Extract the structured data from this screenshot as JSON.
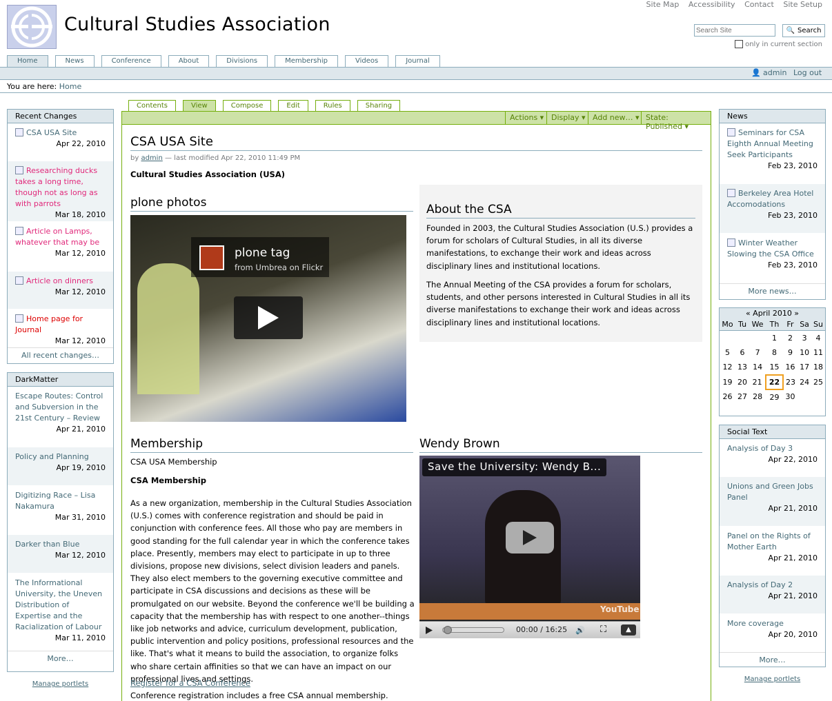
{
  "site_actions": [
    "Site Map",
    "Accessibility",
    "Contact",
    "Site Setup"
  ],
  "site_title": "Cultural Studies Association",
  "search": {
    "placeholder": "Search Site",
    "button": "Search",
    "only_current": "only in current section"
  },
  "global_tabs": [
    "Home",
    "News",
    "Conference",
    "About",
    "Divisions",
    "Membership",
    "Videos",
    "Journal"
  ],
  "personal": {
    "user": "admin",
    "logout": "Log out"
  },
  "breadcrumb": {
    "prefix": "You are here:",
    "home": "Home"
  },
  "content_tabs": [
    "Contents",
    "View",
    "Compose",
    "Edit",
    "Rules",
    "Sharing"
  ],
  "content_actions": [
    "Actions ▾",
    "Display ▾",
    "Add new… ▾",
    "State: Published ▾"
  ],
  "doc": {
    "title": "CSA USA Site",
    "byline_by": "by",
    "author": "admin",
    "byline_rest": "— last modified Apr 22, 2010 11:49 PM",
    "org": "Cultural Studies Association (USA)"
  },
  "plone_photos": {
    "heading": "plone photos",
    "video_title": "plone tag",
    "video_sub": "from Umbrea on Flickr"
  },
  "about": {
    "heading": "About the CSA",
    "p1": "Founded in 2003, the Cultural Studies Association (U.S.) provides a forum for scholars of Cultural Studies, in all its diverse manifestations, to exchange their work and ideas across disciplinary lines and institutional locations.",
    "p2": "The Annual Meeting of the CSA provides a forum for scholars, students, and other persons interested in Cultural Studies in all its diverse manifestations to exchange their work and ideas across disciplinary lines and institutional locations."
  },
  "membership": {
    "heading": "Membership",
    "sub": "CSA USA Membership",
    "bold": "CSA Membership",
    "body": "As a new organization, membership in the Cultural Studies Association (U.S.) comes with conference registration and should be paid in conjunction with conference fees. All those who pay are members in good standing for the full calendar year in which the conference takes place. Presently, members may elect to participate in up to three divisions, propose new divisions, select division leaders and panels. They also elect members to the governing executive committee and participate in CSA discussions and decisions as these will be promulgated on our website. Beyond the conference we'll be building a capacity that the membership has with respect to one another--things like job networks and advice, curriculum development, publication, public intervention and policy positions, professional resources and the like. That's what it means to build the association, to organize folks who share certain affinities so that we can have an impact on our professional lives and settings.",
    "link": "Register for a CSA Conference",
    "after": "Conference registration includes a free CSA annual membership."
  },
  "wendy": {
    "heading": "Wendy Brown",
    "video_title": "Save the University: Wendy B...",
    "time": "00:00 / 16:25",
    "logo": "YouTube"
  },
  "recent_changes": {
    "title": "Recent Changes",
    "items": [
      {
        "label": "CSA USA Site",
        "date": "Apr 22, 2010"
      },
      {
        "label": "Researching ducks takes a long time, though not as long as with parrots",
        "date": "Mar 18, 2010"
      },
      {
        "label": "Article on Lamps, whatever that may be",
        "date": "Mar 12, 2010"
      },
      {
        "label": "Article on dinners",
        "date": "Mar 12, 2010"
      },
      {
        "label": "Home page for Journal",
        "date": "Mar 12, 2010"
      }
    ],
    "more": "All recent changes…"
  },
  "darkmatter": {
    "title": "DarkMatter",
    "items": [
      {
        "label": "Escape Routes: Control and Subversion in the 21st Century – Review",
        "date": "Apr 21, 2010"
      },
      {
        "label": "Policy and Planning",
        "date": "Apr 19, 2010"
      },
      {
        "label": "Digitizing Race – Lisa Nakamura",
        "date": "Mar 31, 2010"
      },
      {
        "label": "Darker than Blue",
        "date": "Mar 12, 2010"
      },
      {
        "label": "The Informational University, the Uneven Distribution of Expertise and the Racialization of Labour",
        "date": "Mar 11, 2010"
      }
    ],
    "more": "More…"
  },
  "manage_portlets": "Manage portlets",
  "news": {
    "title": "News",
    "items": [
      {
        "label": "Seminars for CSA Eighth Annual Meeting Seek Participants",
        "date": "Feb 23, 2010"
      },
      {
        "label": "Berkeley Area Hotel Accomodations",
        "date": "Feb 23, 2010"
      },
      {
        "label": "Winter Weather Slowing the CSA Office",
        "date": "Feb 23, 2010"
      }
    ],
    "more": "More news…"
  },
  "calendar": {
    "title": "« April 2010 »",
    "days": [
      "Mo",
      "Tu",
      "We",
      "Th",
      "Fr",
      "Sa",
      "Su"
    ],
    "weeks": [
      [
        "",
        "",
        "",
        "1",
        "2",
        "3",
        "4"
      ],
      [
        "5",
        "6",
        "7",
        "8",
        "9",
        "10",
        "11"
      ],
      [
        "12",
        "13",
        "14",
        "15",
        "16",
        "17",
        "18"
      ],
      [
        "19",
        "20",
        "21",
        "22",
        "23",
        "24",
        "25"
      ],
      [
        "26",
        "27",
        "28",
        "29",
        "30",
        "",
        ""
      ]
    ],
    "today": "22"
  },
  "social_text": {
    "title": "Social Text",
    "items": [
      {
        "label": "Analysis of Day 3",
        "date": "Apr 22, 2010"
      },
      {
        "label": "Unions and Green Jobs Panel",
        "date": "Apr 21, 2010"
      },
      {
        "label": "Panel on the Rights of Mother Earth",
        "date": "Apr 21, 2010"
      },
      {
        "label": "Analysis of Day 2",
        "date": "Apr 21, 2010"
      },
      {
        "label": "More coverage",
        "date": "Apr 20, 2010"
      }
    ],
    "more": "More…"
  },
  "colors": {
    "accent": "#436976",
    "green": "#74ae0b",
    "pink": "#e0287a",
    "red": "#d00"
  }
}
